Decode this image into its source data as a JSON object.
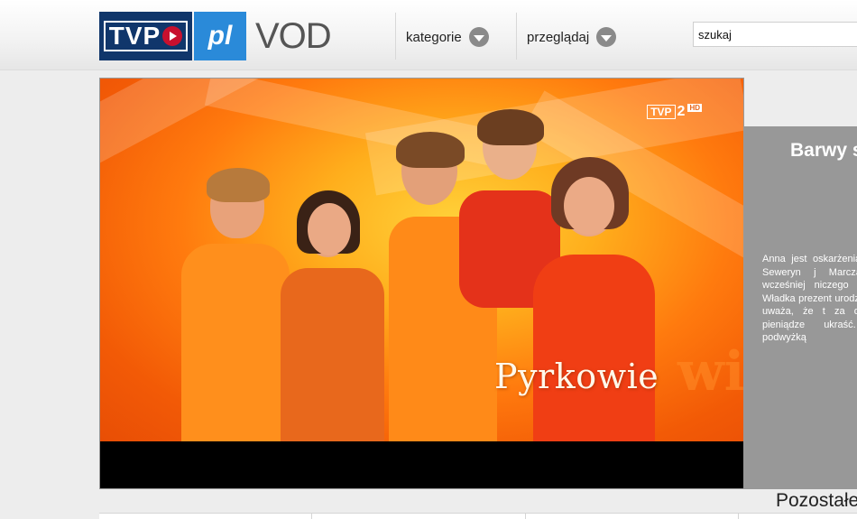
{
  "header": {
    "logo": {
      "tvp": "TVP",
      "pl": "pl",
      "vod": "VOD"
    },
    "nav": [
      {
        "label": "kategorie"
      },
      {
        "label": "przeglądaj"
      }
    ],
    "search": {
      "value": "szukaj"
    }
  },
  "player": {
    "channel_logo": {
      "name": "TVP",
      "number": "2",
      "badge": "HD"
    },
    "show_title": "Pyrkowie",
    "background_word": "wie"
  },
  "info_panel": {
    "title": "Barwy s",
    "description": "Anna jest oskarżeniami Wies że Seweryn j Marczakowa obw wcześniej niczego Kajtek prosi Władka prezent urodzinow Cieślak uważa, że t za dużo. Chłopi pieniądze ukraść. oburzony podwyżką"
  },
  "more_label": "Pozostałe",
  "colors": {
    "tvp_blue": "#10366b",
    "pl_blue": "#2a8ad9",
    "play_red": "#c8102e",
    "panel_gray": "#989898",
    "frame_orange": "#f25a06"
  }
}
